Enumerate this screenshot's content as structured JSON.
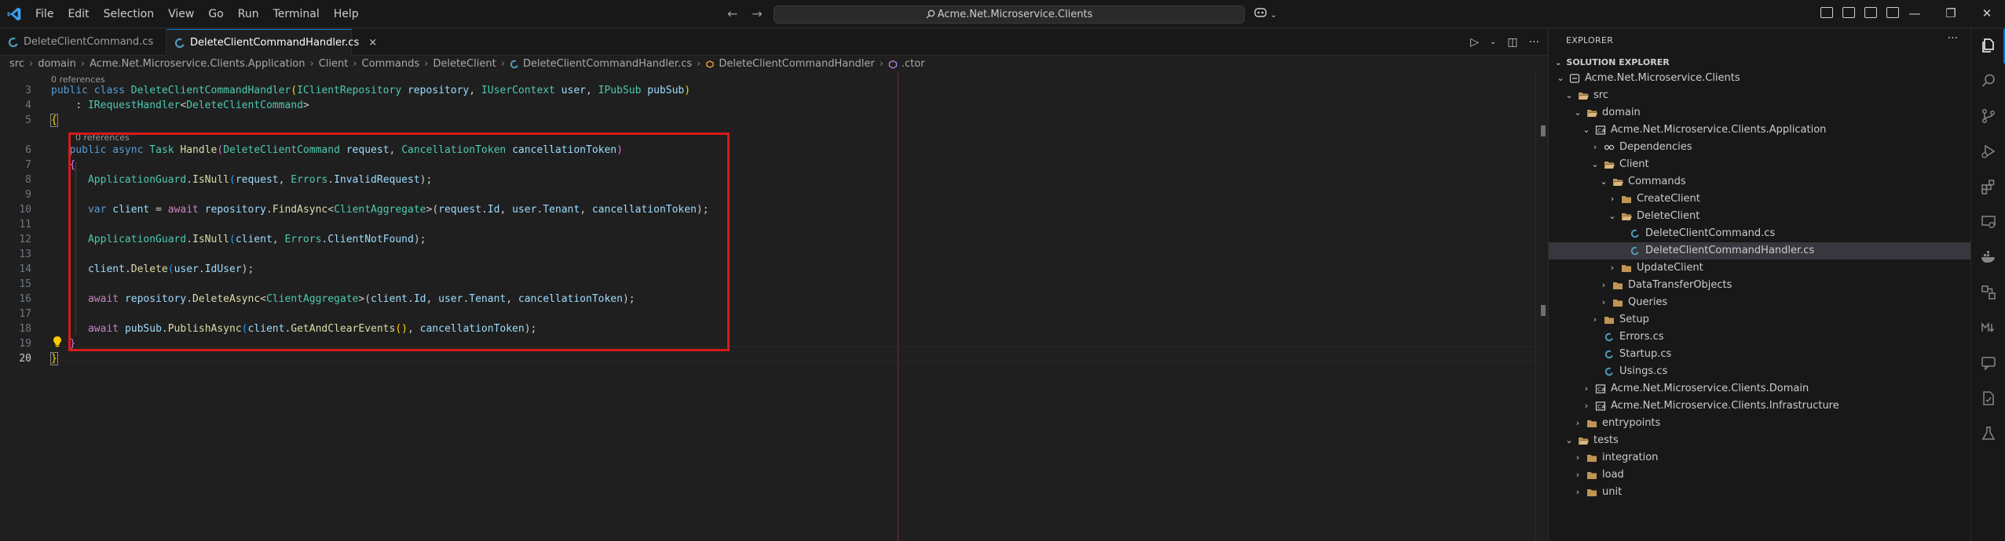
{
  "menu": [
    "File",
    "Edit",
    "Selection",
    "View",
    "Go",
    "Run",
    "Terminal",
    "Help"
  ],
  "search": {
    "text": "Acme.Net.Microservice.Clients"
  },
  "tabs": [
    {
      "label": "DeleteClientCommand.cs",
      "active": false
    },
    {
      "label": "DeleteClientCommandHandler.cs",
      "active": true,
      "close": "×"
    }
  ],
  "breadcrumb": [
    "src",
    "domain",
    "Acme.Net.Microservice.Clients.Application",
    "Client",
    "Commands",
    "DeleteClient",
    "DeleteClientCommandHandler.cs",
    "DeleteClientCommandHandler",
    ".ctor"
  ],
  "editor": {
    "line_numbers": [
      "3",
      "4",
      "5",
      "6",
      "7",
      "8",
      "9",
      "10",
      "11",
      "12",
      "13",
      "14",
      "15",
      "16",
      "17",
      "18",
      "19",
      "20"
    ],
    "codelens_class": "0 references",
    "codelens_method": "0 references",
    "line3": {
      "kw1": "public",
      "kw2": "class",
      "name": "DeleteClientCommandHandler",
      "p1": "(",
      "t1": "IClientRepository",
      "v1": "repository",
      "c1": ",",
      "t2": "IUserContext",
      "v2": "user",
      "c2": ",",
      "t3": "IPubSub",
      "v3": "pubSub",
      "p2": ")"
    },
    "line4": {
      "colon": ": ",
      "t1": "IRequestHandler",
      "lt": "<",
      "t2": "DeleteClientCommand",
      "gt": ">"
    },
    "line5": {
      "brace": "{"
    },
    "line6": {
      "kw1": "public",
      "kw2": "async",
      "t1": "Task",
      "fn": "Handle",
      "p1": "(",
      "t2": "DeleteClientCommand",
      "v1": "request",
      "c1": ",",
      "t3": "CancellationToken",
      "v2": "cancellationToken",
      "p2": ")"
    },
    "line7": {
      "brace": "{"
    },
    "line8": {
      "t1": "ApplicationGuard",
      "dot": ".",
      "fn": "IsNull",
      "p1": "(",
      "v1": "request",
      "c1": ",",
      "t2": "Errors",
      "dot2": ".",
      "v2": "InvalidRequest",
      "p2": ");"
    },
    "line9": {
      "kw": "var",
      "v1": "client",
      "eq": "=",
      "kw2": "await",
      "v2": "repository",
      "dot": ".",
      "fn": "FindAsync",
      "lt": "<",
      "t1": "ClientAggregate",
      "gt": ">(",
      "v3": "request",
      "dot2": ".",
      "v4": "Id",
      "c1": ",",
      "v5": "user",
      "dot3": ".",
      "v6": "Tenant",
      "c2": ",",
      "v7": "cancellationToken",
      "p2": ");"
    },
    "line10": {
      "t1": "ApplicationGuard",
      "dot": ".",
      "fn": "IsNull",
      "p1": "(",
      "v1": "client",
      "c1": ",",
      "t2": "Errors",
      "dot2": ".",
      "v2": "ClientNotFound",
      "p2": ");"
    },
    "line11": {
      "v1": "client",
      "dot": ".",
      "fn": "Delete",
      "p1": "(",
      "v2": "user",
      "dot2": ".",
      "v3": "IdUser",
      "p2": ");"
    },
    "line12": {
      "kw": "await",
      "v1": "repository",
      "dot": ".",
      "fn": "DeleteAsync",
      "lt": "<",
      "t1": "ClientAggregate",
      "gt": ">(",
      "v2": "client",
      "dot2": ".",
      "v3": "Id",
      "c1": ",",
      "v4": "user",
      "dot3": ".",
      "v5": "Tenant",
      "c2": ",",
      "v6": "cancellationToken",
      "p2": ");"
    },
    "line13": {
      "kw": "await",
      "v1": "pubSub",
      "dot": ".",
      "fn": "PublishAsync",
      "p1": "(",
      "v2": "client",
      "dot2": ".",
      "fn2": "GetAndClearEvents",
      "p3": "()",
      "c1": ",",
      "v3": "cancellationToken",
      "p2": ");"
    },
    "line14": {
      "brace": "}"
    },
    "line15": {
      "brace": "}"
    }
  },
  "explorer": {
    "title": "EXPLORER",
    "more": "···",
    "section": "SOLUTION EXPLORER",
    "items": [
      {
        "label": "Acme.Net.Microservice.Clients",
        "twisty": "⌄",
        "icon": "solution-icon"
      },
      {
        "label": "src",
        "twisty": "⌄",
        "icon": "folder-open-icon"
      },
      {
        "label": "domain",
        "twisty": "⌄",
        "icon": "folder-open-icon"
      },
      {
        "label": "Acme.Net.Microservice.Clients.Application",
        "twisty": "⌄",
        "icon": "csproj-icon"
      },
      {
        "label": "Dependencies",
        "twisty": "›",
        "icon": "dependencies-icon"
      },
      {
        "label": "Client",
        "twisty": "⌄",
        "icon": "folder-open-icon"
      },
      {
        "label": "Commands",
        "twisty": "⌄",
        "icon": "folder-open-icon"
      },
      {
        "label": "CreateClient",
        "twisty": "›",
        "icon": "folder-icon"
      },
      {
        "label": "DeleteClient",
        "twisty": "⌄",
        "icon": "folder-open-icon"
      },
      {
        "label": "DeleteClientCommand.cs",
        "twisty": "",
        "icon": "csharp-icon"
      },
      {
        "label": "DeleteClientCommandHandler.cs",
        "twisty": "",
        "icon": "csharp-icon",
        "selected": true
      },
      {
        "label": "UpdateClient",
        "twisty": "›",
        "icon": "folder-icon"
      },
      {
        "label": "DataTransferObjects",
        "twisty": "›",
        "icon": "folder-icon"
      },
      {
        "label": "Queries",
        "twisty": "›",
        "icon": "folder-icon"
      },
      {
        "label": "Setup",
        "twisty": "›",
        "icon": "folder-icon"
      },
      {
        "label": "Errors.cs",
        "twisty": "",
        "icon": "csharp-icon"
      },
      {
        "label": "Startup.cs",
        "twisty": "",
        "icon": "csharp-icon"
      },
      {
        "label": "Usings.cs",
        "twisty": "",
        "icon": "csharp-icon"
      },
      {
        "label": "Acme.Net.Microservice.Clients.Domain",
        "twisty": "›",
        "icon": "csproj-icon"
      },
      {
        "label": "Acme.Net.Microservice.Clients.Infrastructure",
        "twisty": "›",
        "icon": "csproj-icon"
      },
      {
        "label": "entrypoints",
        "twisty": "›",
        "icon": "folder-icon"
      },
      {
        "label": "tests",
        "twisty": "⌄",
        "icon": "folder-open-icon"
      },
      {
        "label": "integration",
        "twisty": "›",
        "icon": "folder-icon"
      },
      {
        "label": "load",
        "twisty": "›",
        "icon": "folder-icon"
      },
      {
        "label": "unit",
        "twisty": "›",
        "icon": "folder-icon"
      }
    ]
  },
  "colors": {
    "accent": "#0078d4",
    "highlight_box": "#d7191c",
    "csharp": "#519aba"
  }
}
